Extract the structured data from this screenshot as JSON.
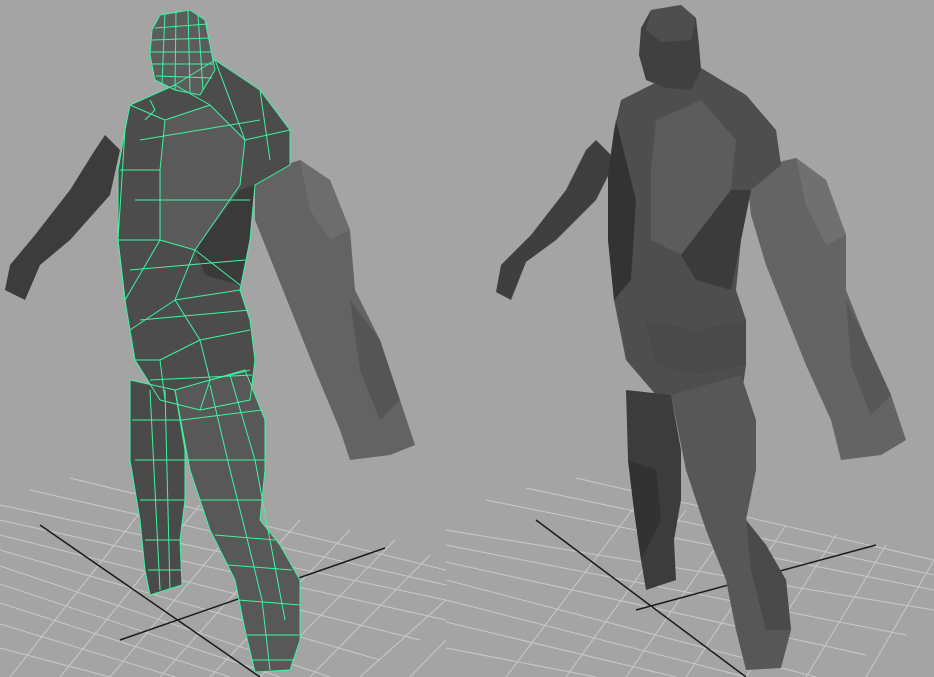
{
  "app": {
    "title": ""
  },
  "viewports": [
    {
      "id": "left",
      "display_mode": "wireframe-on-shaded",
      "selected": true,
      "wire_color": "#3df5a0"
    },
    {
      "id": "right",
      "display_mode": "smooth-shade",
      "selected": false
    }
  ],
  "scene": {
    "object": "character-mesh",
    "background_color": "#a4a4a4",
    "grid_color": "#c8c8c8",
    "grid_axis_color": "#1a1a1a"
  }
}
